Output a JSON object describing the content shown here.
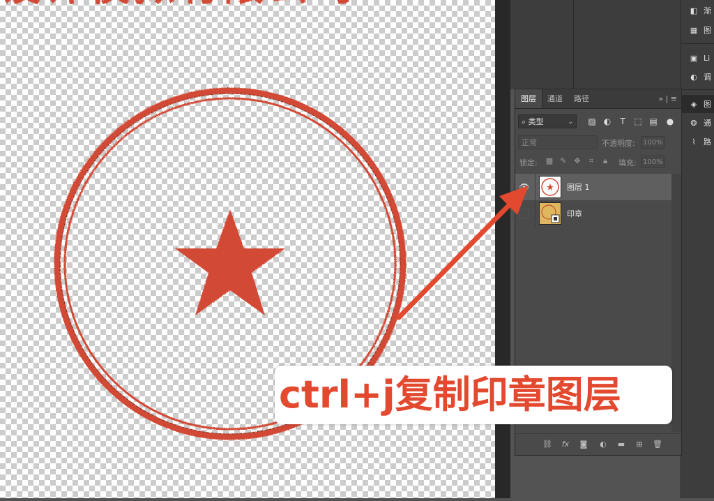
{
  "canvas": {
    "stamp": {
      "text": "设计模拟有限公司",
      "color": "#d24a35"
    }
  },
  "right_column": {
    "items": [
      {
        "icon": "gradient-swatch-icon",
        "label": "渐"
      },
      {
        "icon": "pattern-grid-icon",
        "label": "图"
      },
      {
        "icon": "library-icon",
        "label": "Li"
      },
      {
        "icon": "adjustments-icon",
        "label": "调"
      },
      {
        "icon": "layers-icon",
        "label": "图"
      },
      {
        "icon": "channels-icon",
        "label": "通"
      },
      {
        "icon": "paths-icon",
        "label": "路"
      }
    ]
  },
  "layers_panel": {
    "tabs": [
      "图层",
      "通道",
      "路径"
    ],
    "more": "»",
    "filter_label": "类型",
    "blend_mode": "正常",
    "opacity_label": "不透明度:",
    "opacity_value": "100%",
    "lock_label": "锁定:",
    "fill_label": "填充:",
    "fill_value": "100%",
    "layers": [
      {
        "name": "图层 1",
        "visible": true,
        "selected": true
      },
      {
        "name": "印章",
        "visible": false,
        "selected": false
      }
    ]
  },
  "annotation": {
    "text": "ctrl+j复制印章图层",
    "color": "#e2492f"
  }
}
